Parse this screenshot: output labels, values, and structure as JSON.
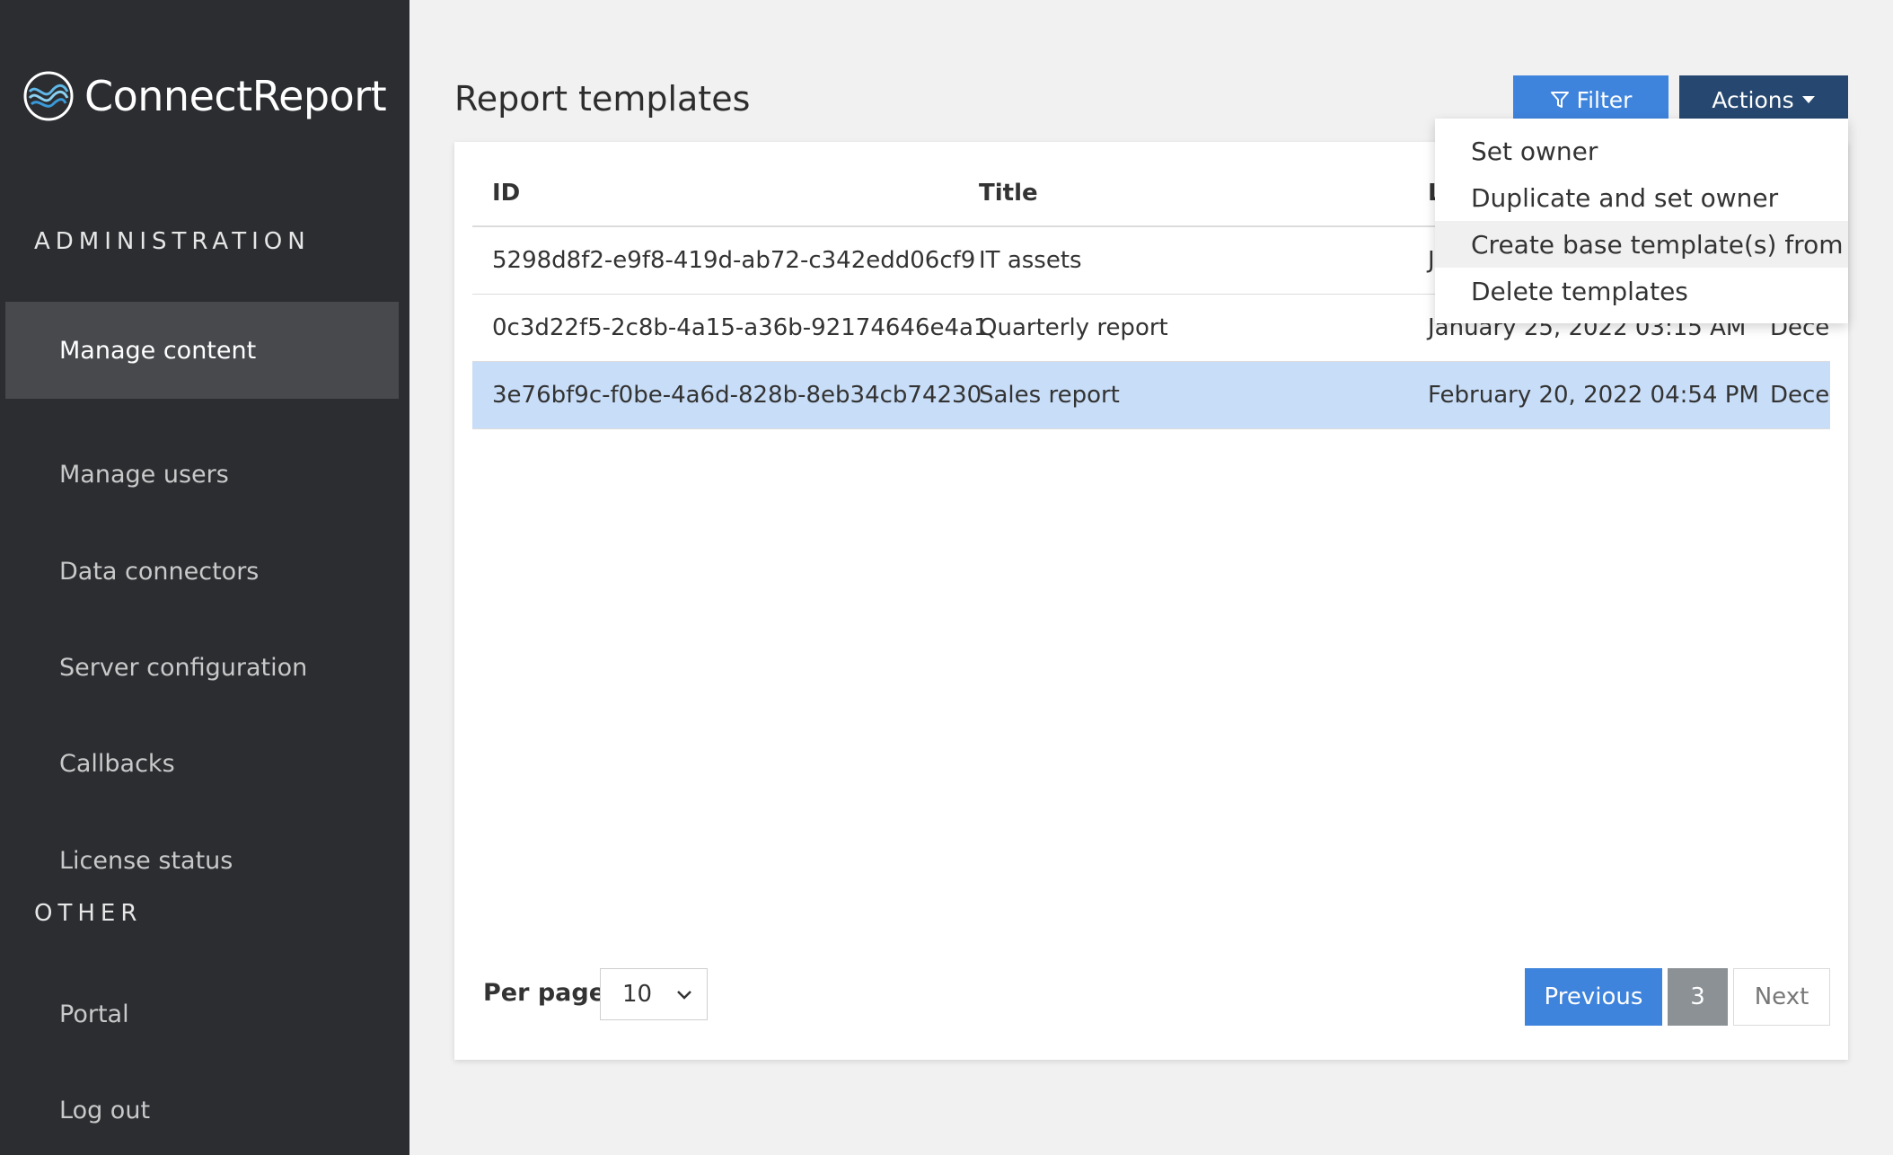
{
  "app": {
    "brand_name": "ConnectReport"
  },
  "sidebar": {
    "sections": [
      {
        "title": "ADMINISTRATION"
      },
      {
        "title": "OTHER"
      }
    ],
    "items": [
      {
        "label": "Manage content",
        "active": true
      },
      {
        "label": "Manage users"
      },
      {
        "label": "Data connectors"
      },
      {
        "label": "Server configuration"
      },
      {
        "label": "Callbacks"
      },
      {
        "label": "License status"
      },
      {
        "label": "Portal"
      },
      {
        "label": "Log out"
      }
    ]
  },
  "main": {
    "title": "Report templates",
    "filter_label": "Filter",
    "actions_label": "Actions",
    "actions_menu": [
      {
        "label": "Set owner"
      },
      {
        "label": "Duplicate and set owner"
      },
      {
        "label": "Create base template(s) from"
      },
      {
        "label": "Delete templates"
      }
    ],
    "table": {
      "headers": {
        "id": "ID",
        "title": "Title",
        "last": "L"
      },
      "rows": [
        {
          "id": "5298d8f2-e9f8-419d-ab72-c342edd06cf9",
          "title": "IT assets",
          "last": "J",
          "created": ""
        },
        {
          "id": "0c3d22f5-2c8b-4a15-a36b-92174646e4a1",
          "title": "Quarterly report",
          "last": "January 25, 2022 03:15 AM",
          "created": "Decei"
        },
        {
          "id": "3e76bf9c-f0be-4a6d-828b-8eb34cb74230",
          "title": "Sales report",
          "last": "February 20, 2022 04:54 PM",
          "created": "Decer",
          "selected": true
        }
      ]
    },
    "pagination": {
      "per_page_label": "Per page",
      "per_page_value": "10",
      "previous": "Previous",
      "current": "3",
      "next": "Next"
    }
  },
  "colors": {
    "sidebar_bg": "#2b2d31",
    "primary": "#3e83dc",
    "actions": "#26476f",
    "selected_row": "#c8ddf7"
  }
}
